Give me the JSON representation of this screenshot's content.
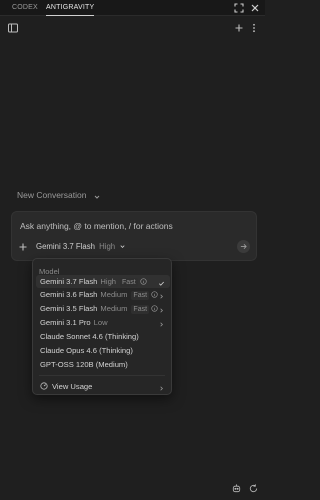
{
  "tabs": [
    {
      "label": "CODEX"
    },
    {
      "label": "ANTIGRAVITY",
      "active": true
    }
  ],
  "icons": {
    "expand": "expand-icon",
    "close": "close-icon",
    "sidebar": "sidebar-toggle-icon",
    "add": "plus-icon",
    "more": "more-vertical-icon",
    "attach": "plus-icon",
    "send": "arrow-right-icon",
    "usage": "gauge-icon",
    "bottom_left": "agent-icon",
    "bottom_right": "refresh-icon"
  },
  "conversation": {
    "title": "New Conversation"
  },
  "composer": {
    "placeholder": "Ask anything, @ to mention, / for actions",
    "model_name": "Gemini 3.7 Flash",
    "model_level": "High"
  },
  "model_menu": {
    "header": "Model",
    "items": [
      {
        "name": "Gemini 3.7 Flash",
        "level": "High",
        "badge": "Fast",
        "info": true,
        "selected": true,
        "checked": true,
        "submenu": false
      },
      {
        "name": "Gemini 3.6 Flash",
        "level": "Medium",
        "badge": "Fast",
        "info": true,
        "selected": false,
        "checked": false,
        "submenu": true
      },
      {
        "name": "Gemini 3.5 Flash",
        "level": "Medium",
        "badge": "Fast",
        "info": true,
        "selected": false,
        "checked": false,
        "submenu": true
      },
      {
        "name": "Gemini 3.1 Pro",
        "level": "Low",
        "badge": "",
        "info": false,
        "selected": false,
        "checked": false,
        "submenu": true
      },
      {
        "name": "Claude Sonnet 4.6 (Thinking)",
        "level": "",
        "badge": "",
        "info": false,
        "selected": false,
        "checked": false,
        "submenu": false
      },
      {
        "name": "Claude Opus 4.6 (Thinking)",
        "level": "",
        "badge": "",
        "info": false,
        "selected": false,
        "checked": false,
        "submenu": false
      },
      {
        "name": "GPT-OSS 120B (Medium)",
        "level": "",
        "badge": "",
        "info": false,
        "selected": false,
        "checked": false,
        "submenu": false
      }
    ],
    "view_usage": "View Usage"
  }
}
